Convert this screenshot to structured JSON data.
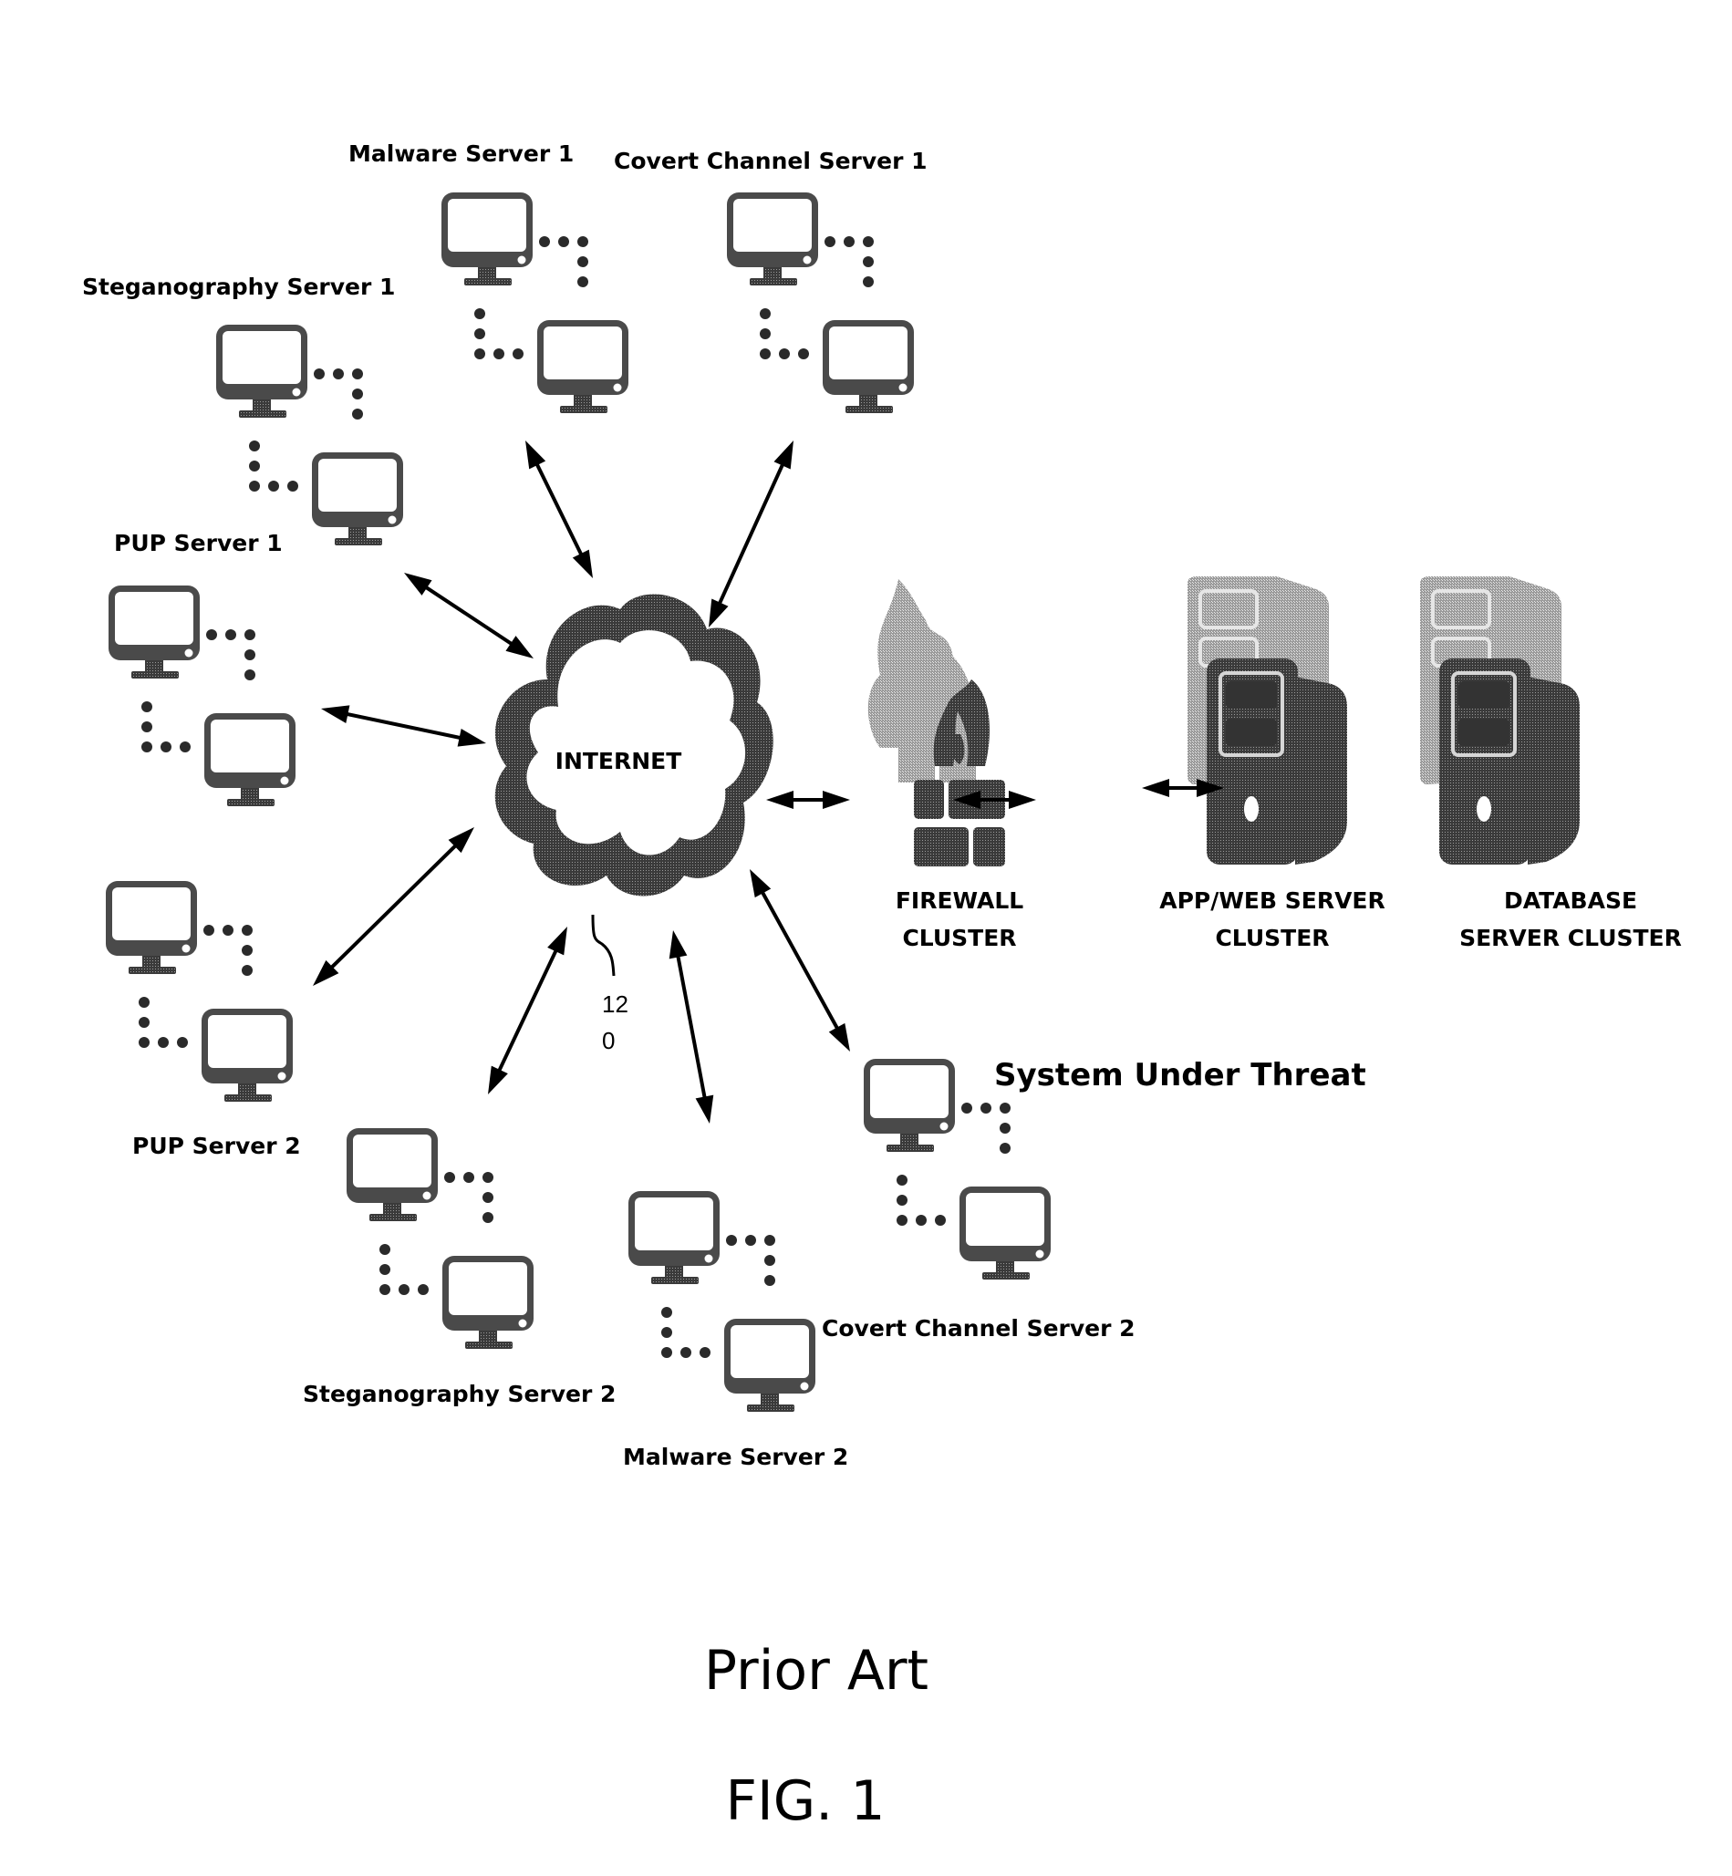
{
  "figure": {
    "caption_prior_art": "Prior Art",
    "caption_fig": "FIG. 1",
    "reference_numeral_line1": "12",
    "reference_numeral_line2": "0"
  },
  "internet": {
    "label": "INTERNET",
    "icon": "cloud-icon"
  },
  "infrastructure": {
    "firewall": {
      "label_line1": "FIREWALL",
      "label_line2": "CLUSTER",
      "icon": "firewall-icon"
    },
    "app_server": {
      "label_line1": "APP/WEB  SERVER",
      "label_line2": "CLUSTER",
      "icon": "server-tower-icon"
    },
    "database": {
      "label_line1": "DATABASE",
      "label_line2": "SERVER CLUSTER",
      "icon": "server-tower-icon"
    }
  },
  "clusters": [
    {
      "id": "steganography-server-1",
      "label": "Steganography  Server  1",
      "icon": "computer-monitor-icon"
    },
    {
      "id": "malware-server-1",
      "label": "Malware  Server  1",
      "icon": "computer-monitor-icon"
    },
    {
      "id": "covert-channel-server-1",
      "label": "Covert  Channel  Server  1",
      "icon": "computer-monitor-icon"
    },
    {
      "id": "pup-server-1",
      "label": "PUP  Server  1",
      "icon": "computer-monitor-icon"
    },
    {
      "id": "pup-server-2",
      "label": "PUP  Server  2",
      "icon": "computer-monitor-icon"
    },
    {
      "id": "steganography-server-2",
      "label": "Steganography  Server  2",
      "icon": "computer-monitor-icon"
    },
    {
      "id": "malware-server-2",
      "label": "Malware  Server  2",
      "icon": "computer-monitor-icon"
    },
    {
      "id": "covert-channel-server-2",
      "label": "Covert  Channel  Server  2",
      "icon": "computer-monitor-icon"
    },
    {
      "id": "system-under-threat",
      "label": "System Under Threat",
      "icon": "computer-monitor-icon"
    }
  ],
  "connections": [
    {
      "from": "malware-server-1",
      "to": "internet",
      "type": "bidirectional"
    },
    {
      "from": "covert-channel-server-1",
      "to": "internet",
      "type": "bidirectional"
    },
    {
      "from": "steganography-server-1",
      "to": "internet",
      "type": "bidirectional"
    },
    {
      "from": "pup-server-1",
      "to": "internet",
      "type": "bidirectional"
    },
    {
      "from": "pup-server-2",
      "to": "internet",
      "type": "bidirectional"
    },
    {
      "from": "steganography-server-2",
      "to": "internet",
      "type": "bidirectional"
    },
    {
      "from": "malware-server-2",
      "to": "internet",
      "type": "bidirectional"
    },
    {
      "from": "system-under-threat",
      "to": "internet",
      "type": "bidirectional"
    },
    {
      "from": "internet",
      "to": "firewall",
      "type": "bidirectional"
    },
    {
      "from": "firewall",
      "to": "app_server",
      "type": "bidirectional"
    },
    {
      "from": "app_server",
      "to": "database",
      "type": "bidirectional"
    }
  ]
}
